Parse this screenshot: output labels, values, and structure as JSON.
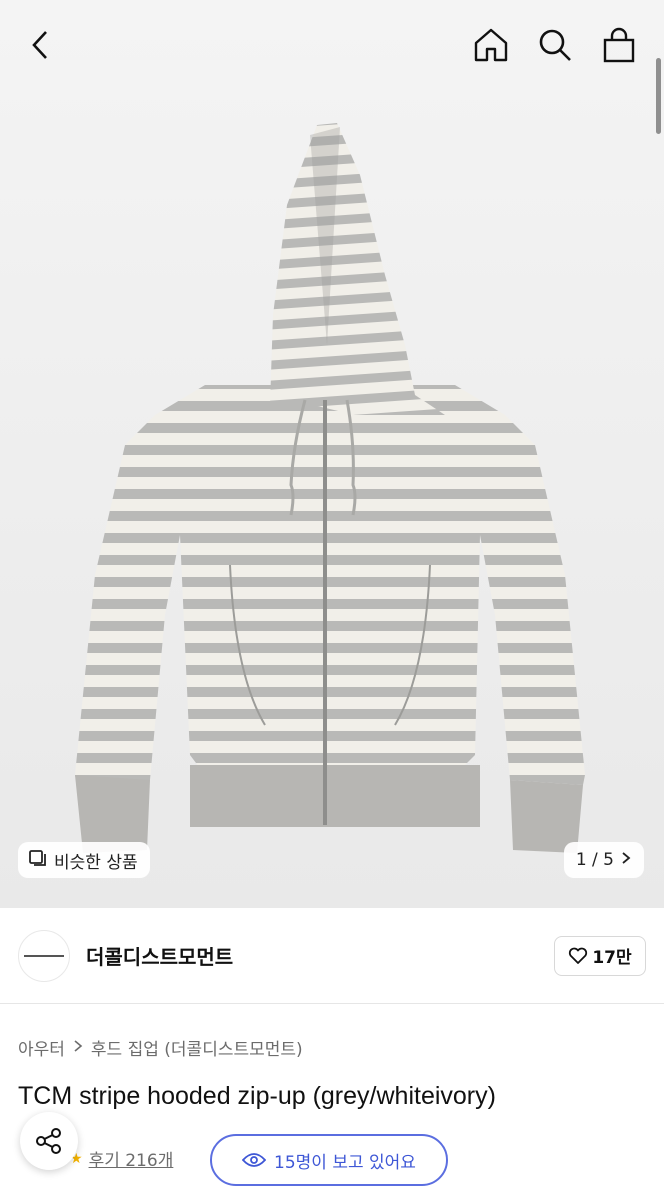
{
  "header": {
    "back_icon": "chevron-left-icon",
    "home_icon": "home-icon",
    "search_icon": "search-icon",
    "cart_icon": "shopping-bag-icon"
  },
  "gallery": {
    "similar_label": "비슷한 상품",
    "similar_icon": "copy-icon",
    "counter": "1 / 5",
    "counter_icon": "chevron-right-icon",
    "image_description_icon": "hoodie-image"
  },
  "shop": {
    "name": "더콜디스트모먼트",
    "likes": "17만",
    "like_icon": "heart-icon"
  },
  "breadcrumb": {
    "items": [
      "아우터",
      "후드 집업 (더콜디스트모먼트)"
    ],
    "separator_icon": "chevron-right-icon"
  },
  "product": {
    "title": "TCM stripe hooded zip-up (grey/whiteivory)"
  },
  "reviews": {
    "label": "후기 216개"
  },
  "viewers": {
    "label": "15명이 보고 있어요",
    "icon": "eye-icon"
  },
  "share": {
    "icon": "share-icon"
  },
  "colors": {
    "accent": "#3e57d6",
    "stripe_grey": "#b9b9b7",
    "stripe_ivory": "#f1efe9"
  }
}
